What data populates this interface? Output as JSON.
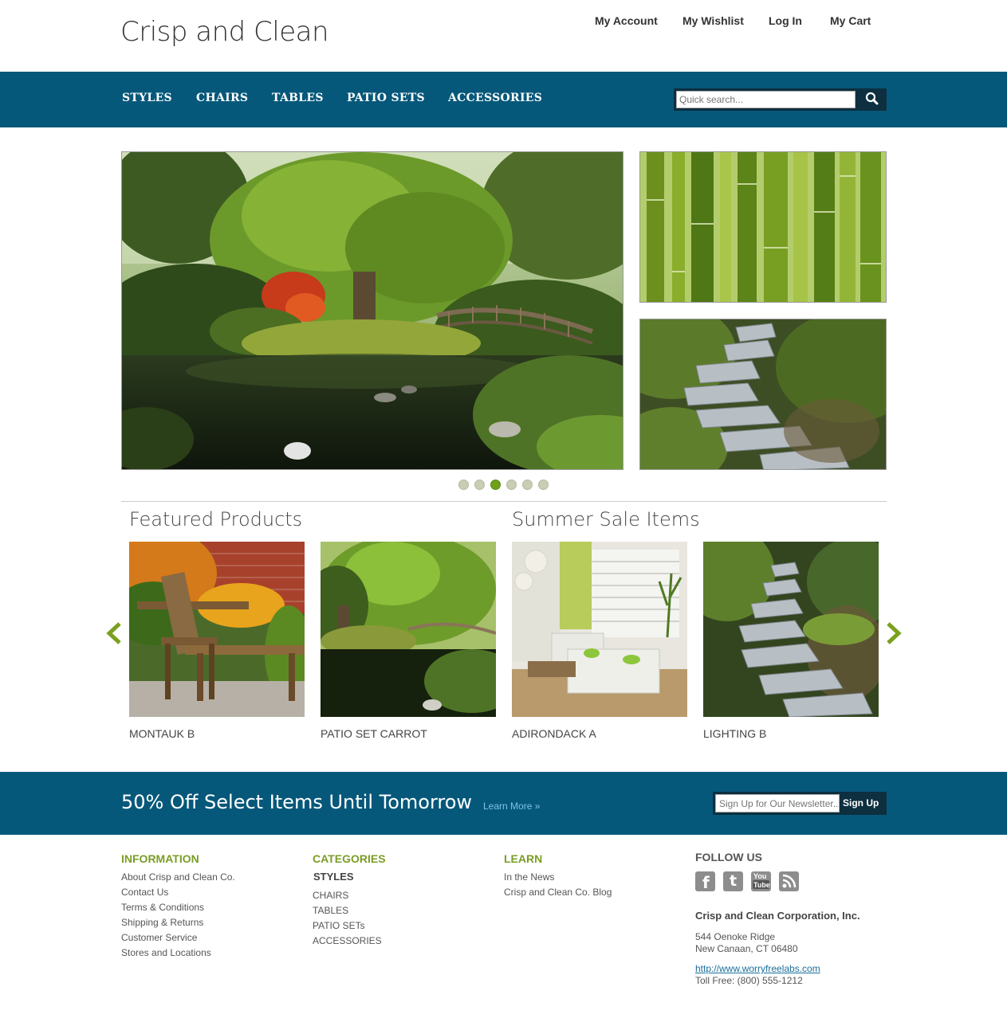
{
  "site": {
    "logo": "Crisp and Clean"
  },
  "top_links": [
    "My Account",
    "My Wishlist",
    "Log In",
    "My Cart"
  ],
  "nav": [
    "STYLES",
    "CHAIRS",
    "TABLES",
    "PATIO SETS",
    "ACCESSORIES"
  ],
  "search": {
    "placeholder": "Quick search...",
    "icon": "magnifier-icon"
  },
  "slider": {
    "dot_count": 6,
    "active_dot": 3
  },
  "sections": {
    "featured": "Featured Products",
    "sale": "Summer Sale Items"
  },
  "products": [
    {
      "name": "MONTAUK B",
      "image": "wooden-patio-chair"
    },
    {
      "name": "PATIO SET CARROT",
      "image": "japanese-garden-bridge"
    },
    {
      "name": "ADIRONDACK A",
      "image": "living-room-sofas"
    },
    {
      "name": "LIGHTING B",
      "image": "stone-stairs"
    }
  ],
  "promo": {
    "text": "50% Off Select Items Until Tomorrow",
    "link": "Learn More »",
    "newsletter_placeholder": "Sign Up for Our Newsletter...",
    "signup_label": "Sign Up"
  },
  "footer": {
    "information": {
      "title": "INFORMATION",
      "links": [
        "About Crisp and Clean Co.",
        "Contact Us",
        "Terms & Conditions",
        "Shipping & Returns",
        "Customer Service",
        "Stores and Locations"
      ]
    },
    "categories": {
      "title": "CATEGORIES",
      "styles": "STYLES",
      "links": [
        "CHAIRS",
        "TABLES",
        "PATIO SETs",
        "ACCESSORIES"
      ]
    },
    "learn": {
      "title": "LEARN",
      "links": [
        "In the News",
        "Crisp and Clean Co. Blog"
      ]
    },
    "follow": {
      "title": "FOLLOW US",
      "icons": [
        "facebook-icon",
        "twitter-icon",
        "youtube-icon",
        "rss-icon"
      ],
      "facebook_glyph": "f",
      "twitter_glyph": "t",
      "youtube_top": "You",
      "youtube_bottom": "Tube"
    },
    "company": "Crisp and Clean Corporation, Inc.",
    "address1": "544 Oenoke Ridge",
    "address2": "New Canaan, CT 06480",
    "url": "http://www.worryfreelabs.com",
    "phone": "Toll Free: (800) 555-1212"
  },
  "colors": {
    "nav_bg": "#06587a",
    "accent_green": "#7b9d25",
    "link_blue": "#1a6f9a"
  }
}
